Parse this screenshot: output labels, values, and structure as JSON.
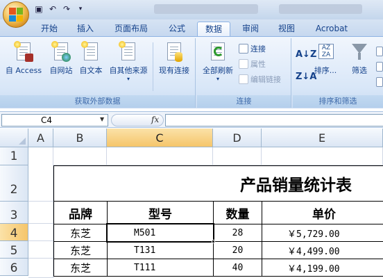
{
  "app": {
    "quick_access": [
      "save-icon",
      "undo-icon",
      "redo-icon",
      "customize-icon"
    ]
  },
  "tabs": [
    {
      "label": "开始"
    },
    {
      "label": "插入"
    },
    {
      "label": "页面布局"
    },
    {
      "label": "公式"
    },
    {
      "label": "数据",
      "active": true
    },
    {
      "label": "审阅"
    },
    {
      "label": "视图"
    },
    {
      "label": "Acrobat"
    }
  ],
  "ribbon": {
    "external_data": {
      "label": "获取外部数据",
      "access": "自 Access",
      "web": "自网站",
      "text": "自文本",
      "other": "自其他来源",
      "existing": "现有连接"
    },
    "connections": {
      "label": "连接",
      "refresh_all": "全部刷新",
      "connections": "连接",
      "properties": "属性",
      "edit_links": "编辑链接"
    },
    "sort_filter": {
      "label": "排序和筛选",
      "sort": "排序...",
      "filter": "筛选"
    }
  },
  "formula_bar": {
    "name_box": "C4",
    "fx": "fx",
    "value": ""
  },
  "grid": {
    "columns": [
      "A",
      "B",
      "C",
      "D",
      "E"
    ],
    "selected_column": "C",
    "rows": [
      "1",
      "2",
      "3",
      "4",
      "5",
      "6"
    ],
    "selected_row": "4"
  },
  "table": {
    "title": "产品销量统计表",
    "headers": [
      "品牌",
      "型号",
      "数量",
      "单价"
    ],
    "rows": [
      {
        "brand": "东芝",
        "model": "M501",
        "qty": "28",
        "price": "￥5,729.00"
      },
      {
        "brand": "东芝",
        "model": "T131",
        "qty": "20",
        "price": "￥4,499.00"
      },
      {
        "brand": "东芝",
        "model": "T111",
        "qty": "40",
        "price": "￥4,199.00"
      }
    ]
  },
  "accent_colors": {
    "selection": "#f5c56a",
    "ribbon_text": "#15428b"
  }
}
